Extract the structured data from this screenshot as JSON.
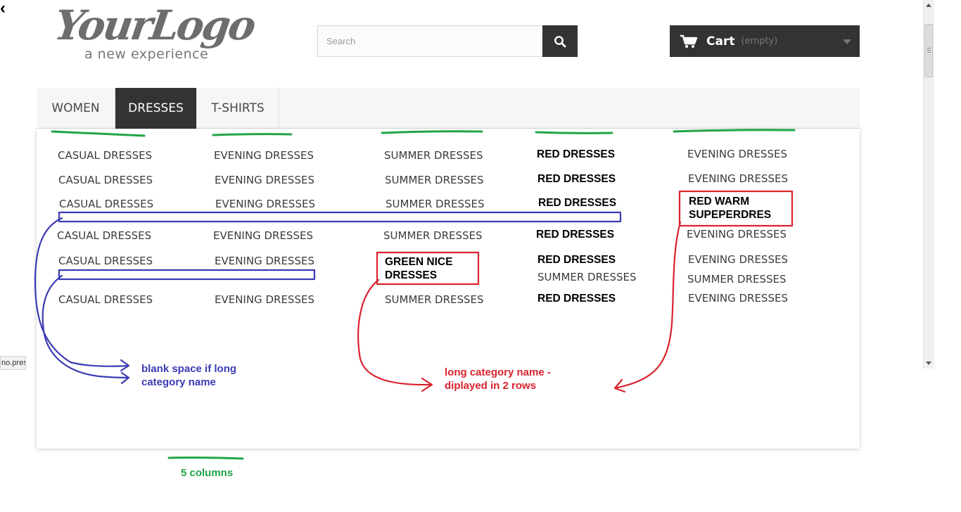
{
  "header": {
    "logo": {
      "main": "YourLogo",
      "sub": "a new experience"
    },
    "search": {
      "placeholder": "Search"
    },
    "cart": {
      "label": "Cart",
      "status": "(empty)"
    }
  },
  "menu": {
    "tabs": [
      {
        "label": "WOMEN",
        "active": false
      },
      {
        "label": "DRESSES",
        "active": true
      },
      {
        "label": "T-SHIRTS",
        "active": false
      }
    ]
  },
  "categories": {
    "col1": [
      "CASUAL DRESSES",
      "CASUAL DRESSES",
      "CASUAL DRESSES",
      "CASUAL DRESSES",
      "CASUAL DRESSES",
      "CASUAL DRESSES"
    ],
    "col2": [
      "EVENING DRESSES",
      "EVENING DRESSES",
      "EVENING DRESSES",
      "EVENING DRESSES",
      "EVENING DRESSES",
      "EVENING DRESSES"
    ],
    "col3": [
      "SUMMER DRESSES",
      "SUMMER DRESSES",
      "SUMMER DRESSES",
      "SUMMER DRESSES",
      "GREEN NICE DRESSES",
      "SUMMER DRESSES"
    ],
    "col4": [
      "RED DRESSES",
      "RED DRESSES",
      "RED DRESSES",
      "RED DRESSES",
      "RED DRESSES",
      "SUMMER DRESSES",
      "RED DRESSES"
    ],
    "col5": [
      "EVENING DRESSES",
      "EVENING DRESSES",
      "RED WARM SUPEPERDRES",
      "EVENING DRESSES",
      "EVENING DRESSES",
      "SUMMER DRESSES",
      "EVENING DRESSES"
    ]
  },
  "annotations": {
    "blank_space": "blank space if long category name",
    "two_rows": "long category name - diplayed in 2 rows",
    "columns": "5 columns"
  },
  "annotation_colors": {
    "blue": "#3b3bb5",
    "red": "#d9232e",
    "green": "#22a447"
  },
  "status_bar": {
    "url": "no.prest"
  },
  "colors": {
    "dark": "#333333",
    "menu_bg": "#f6f6f6"
  },
  "icons": [
    "search-icon",
    "cart-icon",
    "chevron-down-icon"
  ]
}
